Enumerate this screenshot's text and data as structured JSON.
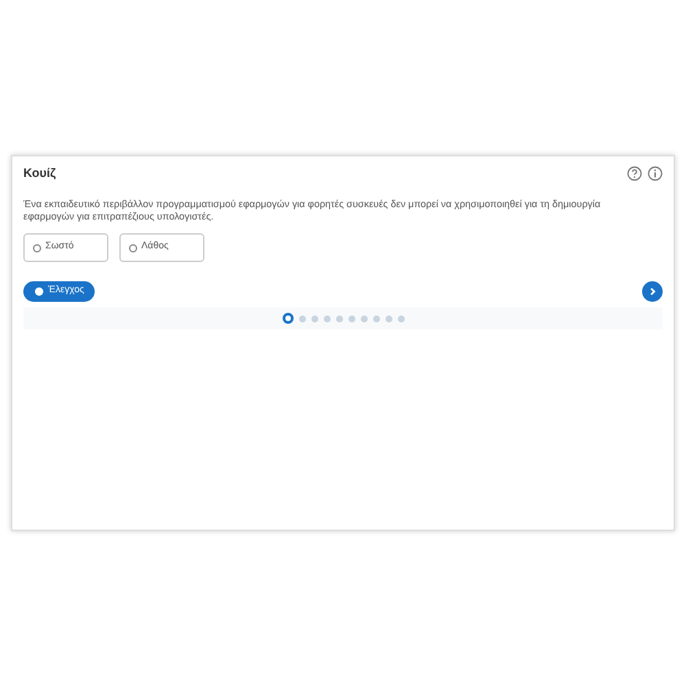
{
  "title": "Κουίζ",
  "question": "Ένα εκπαιδευτικό περιβάλλον προγραμματισμού εφαρμογών για φορητές συσκευές δεν μπορεί να χρησιμοποιηθεί για τη δημιουργία εφαρμογών για επιτραπέζιους υπολογιστές.",
  "options": [
    {
      "label": "Σωστό",
      "selected": false
    },
    {
      "label": "Λάθος",
      "selected": false
    }
  ],
  "check_button": "Έλεγχος",
  "pages": [
    {
      "selected": true
    },
    {
      "selected": false
    },
    {
      "selected": false
    },
    {
      "selected": false
    },
    {
      "selected": false
    },
    {
      "selected": false
    },
    {
      "selected": false
    },
    {
      "selected": false
    },
    {
      "selected": false
    },
    {
      "selected": false
    }
  ]
}
